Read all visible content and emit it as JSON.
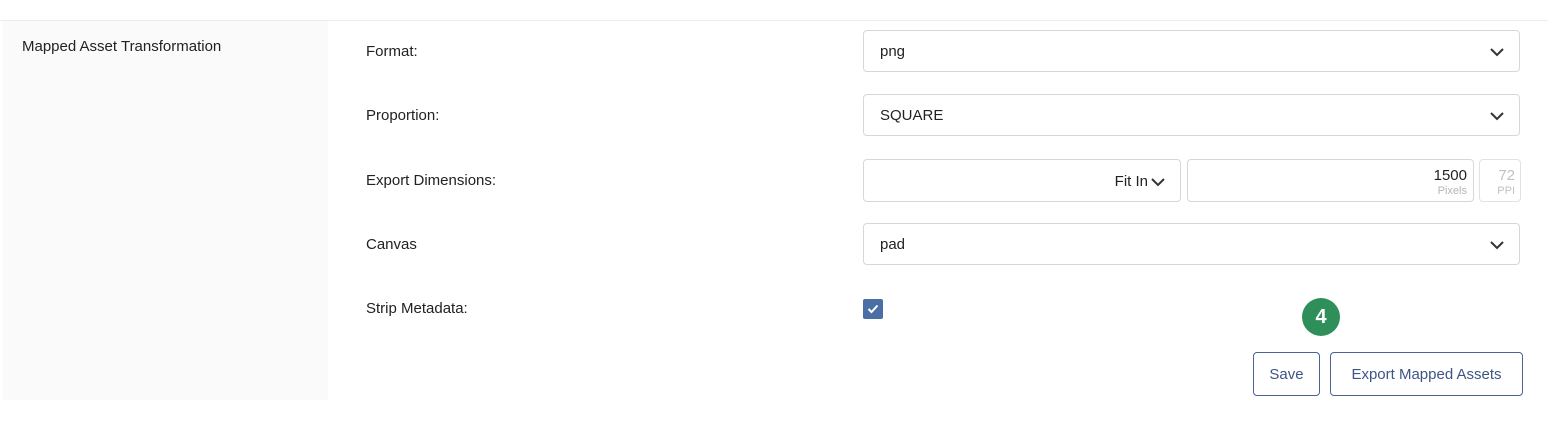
{
  "section": {
    "title": "Mapped Asset Transformation"
  },
  "fields": {
    "format": {
      "label": "Format:",
      "value": "png"
    },
    "proportion": {
      "label": "Proportion:",
      "value": "SQUARE"
    },
    "export_dimensions": {
      "label": "Export Dimensions:",
      "fit_mode": "Fit In",
      "pixels_value": "1500",
      "pixels_unit": "Pixels",
      "ppi_value": "72",
      "ppi_unit": "PPI"
    },
    "canvas": {
      "label": "Canvas",
      "value": "pad"
    },
    "strip_metadata": {
      "label": "Strip Metadata:",
      "checked": true
    }
  },
  "step_badge": "4",
  "actions": {
    "save_label": "Save",
    "export_label": "Export Mapped Assets"
  },
  "colors": {
    "checkbox": "#4a6fa5",
    "badge": "#2f8f5b",
    "button_border": "#4a6394"
  },
  "icons": [
    "chevron-down-icon",
    "check-icon"
  ]
}
